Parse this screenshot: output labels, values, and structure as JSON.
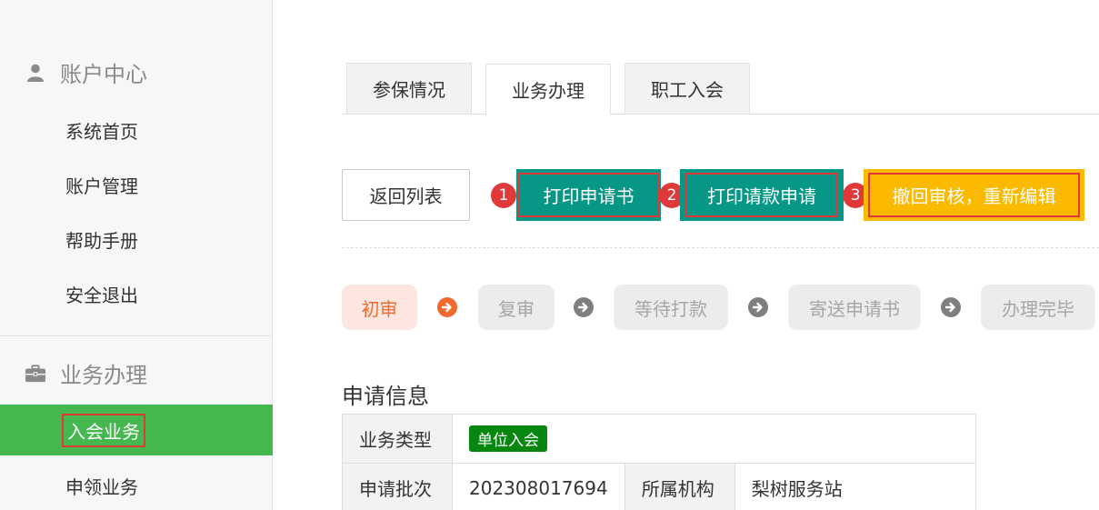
{
  "sidebar": {
    "sections": [
      {
        "title": "账户中心",
        "icon": "user-icon",
        "items": [
          "系统首页",
          "账户管理",
          "帮助手册",
          "安全退出"
        ]
      },
      {
        "title": "业务办理",
        "icon": "briefcase-icon",
        "items": [
          "入会业务",
          "申领业务"
        ],
        "active": "入会业务"
      }
    ]
  },
  "tabs": [
    {
      "label": "参保情况",
      "active": false
    },
    {
      "label": "业务办理",
      "active": true
    },
    {
      "label": "职工入会",
      "active": false
    }
  ],
  "actions": {
    "back_label": "返回列表",
    "print_application_label": "打印申请书",
    "print_payment_label": "打印请款申请",
    "withdraw_label": "撤回审核，重新编辑",
    "markers": [
      "1",
      "2",
      "3"
    ]
  },
  "steps": [
    {
      "label": "初审",
      "current": true
    },
    {
      "label": "复审",
      "current": false
    },
    {
      "label": "等待打款",
      "current": false
    },
    {
      "label": "寄送申请书",
      "current": false
    },
    {
      "label": "办理完毕",
      "current": false
    }
  ],
  "info": {
    "title": "申请信息",
    "business_type_label": "业务类型",
    "business_type_value": "单位入会",
    "batch_label": "申请批次",
    "batch_value": "202308017694",
    "org_label": "所属机构",
    "org_value": "梨树服务站"
  },
  "colors": {
    "active_green": "#45b74f",
    "teal": "#079787",
    "amber": "#fbb900",
    "marker_red": "#e0393a",
    "step_orange": "#f06a2f"
  }
}
